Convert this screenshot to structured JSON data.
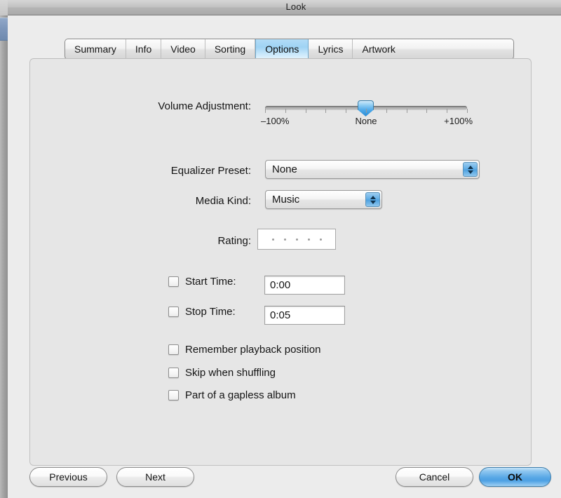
{
  "window": {
    "title": "Look"
  },
  "tabs": [
    {
      "label": "Summary",
      "selected": false
    },
    {
      "label": "Info",
      "selected": false
    },
    {
      "label": "Video",
      "selected": false
    },
    {
      "label": "Sorting",
      "selected": false
    },
    {
      "label": "Options",
      "selected": true
    },
    {
      "label": "Lyrics",
      "selected": false
    },
    {
      "label": "Artwork",
      "selected": false
    }
  ],
  "options": {
    "volume": {
      "label": "Volume Adjustment:",
      "min_label": "–100%",
      "mid_label": "None",
      "max_label": "+100%",
      "value": 0,
      "tick_count": 11
    },
    "equalizer": {
      "label": "Equalizer Preset:",
      "value": "None"
    },
    "media_kind": {
      "label": "Media Kind:",
      "value": "Music"
    },
    "rating": {
      "label": "Rating:",
      "stars": 5,
      "value": 0
    },
    "start_time": {
      "label": "Start Time:",
      "value": "0:00",
      "checked": false
    },
    "stop_time": {
      "label": "Stop Time:",
      "value": "0:05",
      "checked": false
    },
    "checkboxes": [
      {
        "label": "Remember playback position",
        "checked": false
      },
      {
        "label": "Skip when shuffling",
        "checked": false
      },
      {
        "label": "Part of a gapless album",
        "checked": false
      }
    ]
  },
  "buttons": {
    "previous": "Previous",
    "next": "Next",
    "cancel": "Cancel",
    "ok": "OK"
  },
  "colors": {
    "accent": "#4fa2e0",
    "selected_tab": "#9fd3f4",
    "window_bg": "#ececec",
    "group_bg": "#e6e6e6"
  }
}
